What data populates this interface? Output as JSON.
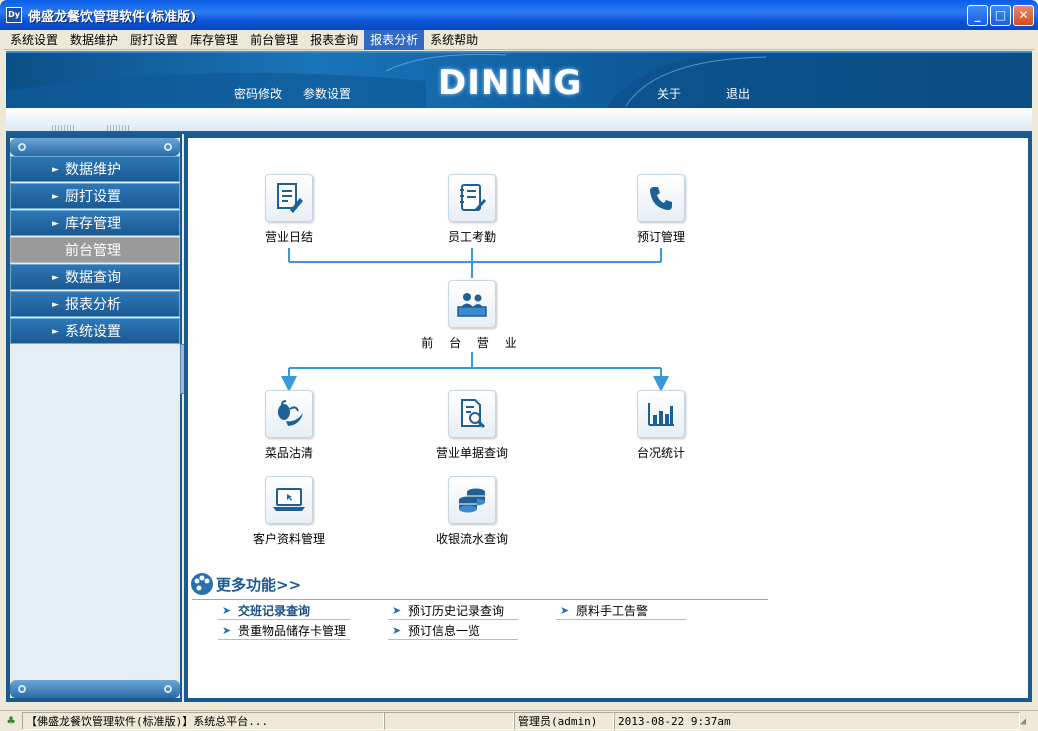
{
  "window": {
    "title": "佛盛龙餐饮管理软件(标准版)",
    "app_icon_text": "Dy",
    "minimize": "_",
    "maximize": "□",
    "close": "✕"
  },
  "menu": [
    {
      "label": "系统设置",
      "active": false
    },
    {
      "label": "数据维护",
      "active": false
    },
    {
      "label": "厨打设置",
      "active": false
    },
    {
      "label": "库存管理",
      "active": false
    },
    {
      "label": "前台管理",
      "active": false
    },
    {
      "label": "报表查询",
      "active": false
    },
    {
      "label": "报表分析",
      "active": true
    },
    {
      "label": "系统帮助",
      "active": false
    }
  ],
  "banner": {
    "password_link": "密码修改",
    "params_link": "参数设置",
    "logo": "DINING",
    "about_link": "关于",
    "exit_link": "退出"
  },
  "sidebar": {
    "items": [
      {
        "label": "数据维护",
        "current": false
      },
      {
        "label": "厨打设置",
        "current": false
      },
      {
        "label": "库存管理",
        "current": false
      },
      {
        "label": "前台管理",
        "current": true
      },
      {
        "label": "数据查询",
        "current": false
      },
      {
        "label": "报表分析",
        "current": false
      },
      {
        "label": "系统设置",
        "current": false
      }
    ]
  },
  "flow": {
    "daily_close": {
      "label": "营业日结",
      "icon": "document-edit-icon"
    },
    "attendance": {
      "label": "员工考勤",
      "icon": "checklist-icon"
    },
    "reservation": {
      "label": "预订管理",
      "icon": "phone-icon"
    },
    "front_business": {
      "label": "前 台 营 业",
      "icon": "front-desk-icon"
    },
    "dish_clearance": {
      "label": "菜品沽清",
      "icon": "pepper-icon"
    },
    "bill_query": {
      "label": "营业单据查询",
      "icon": "document-search-icon"
    },
    "table_stats": {
      "label": "台况统计",
      "icon": "bar-chart-icon"
    },
    "customer": {
      "label": "客户资料管理",
      "icon": "laptop-icon"
    },
    "cash_flow": {
      "label": "收银流水查询",
      "icon": "coins-icon"
    }
  },
  "more": {
    "title": "更多功能>>",
    "links": [
      {
        "label": "交班记录查询",
        "bold": true
      },
      {
        "label": "预订历史记录查询",
        "bold": false
      },
      {
        "label": "原料手工告警",
        "bold": false
      },
      {
        "label": "贵重物品储存卡管理",
        "bold": false
      },
      {
        "label": "预订信息一览",
        "bold": false
      }
    ]
  },
  "status": {
    "app_info": "【佛盛龙餐饮管理软件(标准版)】系统总平台...",
    "blank": "",
    "user": "管理员(admin)",
    "datetime": "2013-08-22 9:37am"
  },
  "colors": {
    "accent": "#1a5a8e",
    "menu_highlight": "#316ac5",
    "flow_line": "#3a9ad6"
  }
}
